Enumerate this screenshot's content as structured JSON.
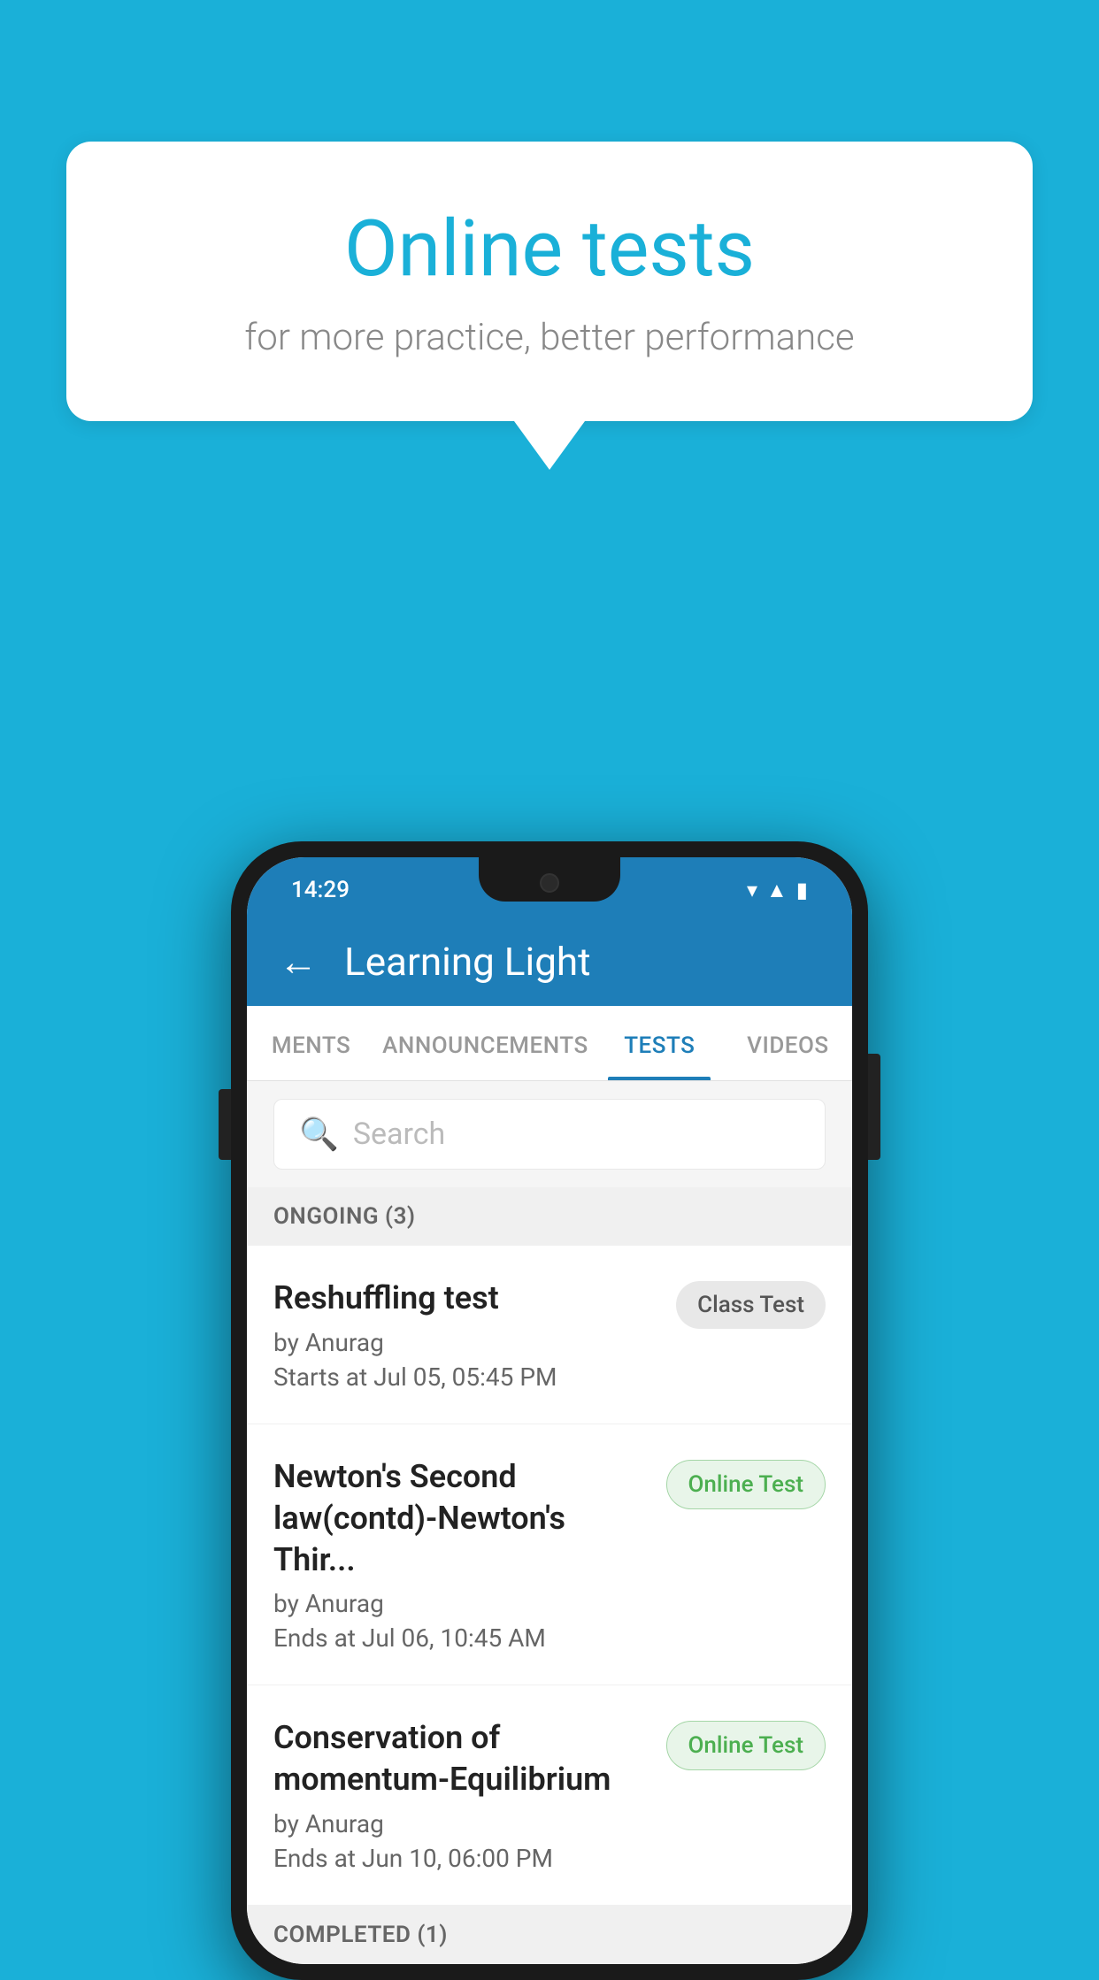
{
  "background": {
    "color": "#1ab0d8"
  },
  "speech_bubble": {
    "title": "Online tests",
    "subtitle": "for more practice, better performance"
  },
  "phone": {
    "status_bar": {
      "time": "14:29",
      "icons": [
        "wifi",
        "signal",
        "battery"
      ]
    },
    "app_bar": {
      "title": "Learning Light",
      "back_label": "←"
    },
    "tabs": [
      {
        "label": "MENTS",
        "active": false
      },
      {
        "label": "ANNOUNCEMENTS",
        "active": false
      },
      {
        "label": "TESTS",
        "active": true
      },
      {
        "label": "VIDEOS",
        "active": false
      }
    ],
    "search": {
      "placeholder": "Search"
    },
    "sections": [
      {
        "header": "ONGOING (3)",
        "items": [
          {
            "title": "Reshuffling test",
            "author": "by Anurag",
            "date": "Starts at  Jul 05, 05:45 PM",
            "badge": "Class Test",
            "badge_type": "class"
          },
          {
            "title": "Newton's Second law(contd)-Newton's Thir...",
            "author": "by Anurag",
            "date": "Ends at  Jul 06, 10:45 AM",
            "badge": "Online Test",
            "badge_type": "online"
          },
          {
            "title": "Conservation of momentum-Equilibrium",
            "author": "by Anurag",
            "date": "Ends at  Jun 10, 06:00 PM",
            "badge": "Online Test",
            "badge_type": "online"
          }
        ]
      },
      {
        "header": "COMPLETED (1)",
        "items": []
      }
    ]
  }
}
